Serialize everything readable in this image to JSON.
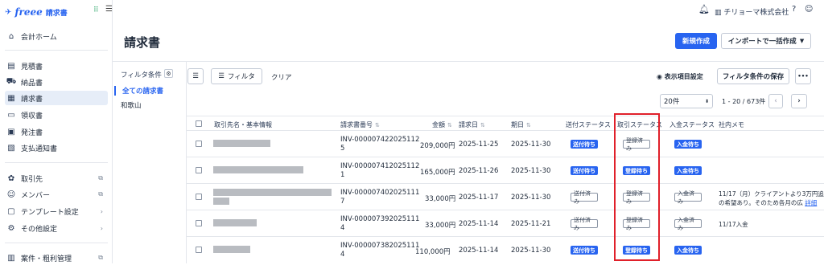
{
  "app": {
    "logo": "freee",
    "product": "請求書",
    "org_name": "チリョーマ株式会社"
  },
  "sidebar": {
    "items": [
      {
        "label": "会計ホーム",
        "icon": "home-icon"
      },
      {
        "label": "見積書",
        "icon": "document-icon"
      },
      {
        "label": "納品書",
        "icon": "truck-icon"
      },
      {
        "label": "請求書",
        "icon": "invoice-icon"
      },
      {
        "label": "領収書",
        "icon": "receipt-icon"
      },
      {
        "label": "発注書",
        "icon": "clipboard-icon"
      },
      {
        "label": "支払通知書",
        "icon": "payment-icon"
      },
      {
        "label": "取引先",
        "icon": "partner-icon"
      },
      {
        "label": "メンバー",
        "icon": "members-icon"
      },
      {
        "label": "テンプレート設定",
        "icon": "template-icon"
      },
      {
        "label": "その他設定",
        "icon": "settings-icon"
      },
      {
        "label": "案件・粗利管理",
        "icon": "project-icon"
      }
    ]
  },
  "page": {
    "title": "請求書",
    "new_button": "新規作成",
    "import_button": "インポートで一括作成"
  },
  "filter_pane": {
    "header": "フィルタ条件",
    "items": [
      "全ての請求書",
      "和歌山"
    ]
  },
  "toolbar": {
    "filter_button": "フィルタ",
    "clear": "クリア",
    "display_settings": "表示項目設定",
    "save_filter": "フィルタ条件の保存",
    "more": "•••",
    "per_page": "20件",
    "range": "1 - 20 / 673件"
  },
  "table": {
    "headers": [
      "取引先名・基本情報",
      "請求書番号",
      "金額",
      "請求日",
      "期日",
      "送付ステータス",
      "取引ステータス",
      "入金ステータス",
      "社内メモ"
    ],
    "rows": [
      {
        "invoice_no_1": "INV-000007422025112",
        "invoice_no_2": "5",
        "amount": "209,000円",
        "issue_date": "2025-11-25",
        "due_date": "2025-11-30",
        "send_status": "送付待ち",
        "trade_status": "登録済み",
        "payment_status": "入金待ち",
        "memo_1": "",
        "memo_2": "",
        "memo_link": ""
      },
      {
        "invoice_no_1": "INV-000007412025112",
        "invoice_no_2": "1",
        "amount": "165,000円",
        "issue_date": "2025-11-26",
        "due_date": "2025-11-30",
        "send_status": "送付待ち",
        "trade_status": "登録待ち",
        "payment_status": "入金待ち",
        "memo_1": "",
        "memo_2": "",
        "memo_link": ""
      },
      {
        "invoice_no_1": "INV-000007402025111",
        "invoice_no_2": "7",
        "amount": "33,000円",
        "issue_date": "2025-11-17",
        "due_date": "2025-11-30",
        "send_status": "送付済み",
        "trade_status": "登録済み",
        "payment_status": "入金済み",
        "memo_1": "11/17（月）クライアントより3万円追加能",
        "memo_2": "の希望あり。そのため各月の広",
        "memo_link": "詳細"
      },
      {
        "invoice_no_1": "INV-000007392025111",
        "invoice_no_2": "4",
        "amount": "33,000円",
        "issue_date": "2025-11-14",
        "due_date": "2025-11-21",
        "send_status": "送付済み",
        "trade_status": "登録済み",
        "payment_status": "入金済み",
        "memo_1": "11/17入金",
        "memo_2": "",
        "memo_link": ""
      },
      {
        "invoice_no_1": "INV-000007382025111",
        "invoice_no_2": "4",
        "amount": "110,000円",
        "issue_date": "2025-11-14",
        "due_date": "2025-11-30",
        "send_status": "送付待ち",
        "trade_status": "登録待ち",
        "payment_status": "入金待ち",
        "memo_1": "",
        "memo_2": "",
        "memo_link": ""
      }
    ]
  },
  "colors": {
    "accent": "#2864f0",
    "highlight": "#e0202a"
  }
}
